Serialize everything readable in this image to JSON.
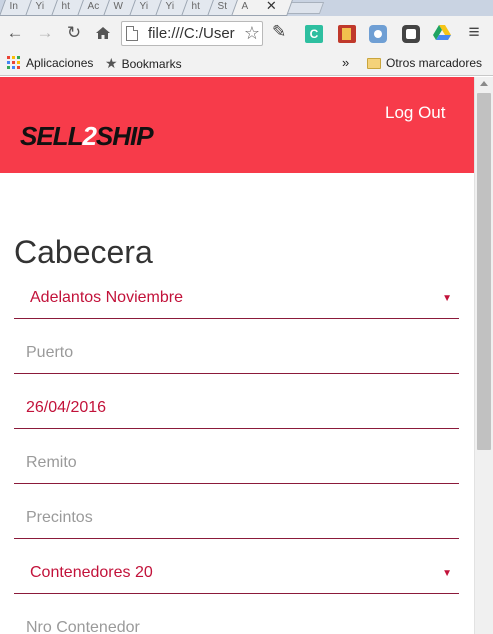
{
  "browser": {
    "tabs": [
      "In",
      "Yi",
      "ht",
      "Ac",
      "W",
      "Yi",
      "Yi",
      "ht",
      "St",
      "A"
    ],
    "active_tab_close": "✕",
    "url": "file:///C:/User",
    "bookmarks": {
      "apps_label": "Aplicaciones",
      "bookmarks_label": "Bookmarks",
      "overflow": "»",
      "other_label": "Otros marcadores"
    }
  },
  "app": {
    "brand_color": "#f73b4a",
    "accent_color": "#c2123a",
    "logo": {
      "part1": "SELL",
      "part2": "2",
      "part3": "SHIP"
    },
    "logout_label": "Log Out",
    "form": {
      "title": "Cabecera",
      "fields": [
        {
          "type": "select",
          "value": "Adelantos Noviembre",
          "placeholder": ""
        },
        {
          "type": "input",
          "value": "",
          "placeholder": "Puerto"
        },
        {
          "type": "input",
          "value": "26/04/2016",
          "placeholder": ""
        },
        {
          "type": "input",
          "value": "",
          "placeholder": "Remito"
        },
        {
          "type": "input",
          "value": "",
          "placeholder": "Precintos"
        },
        {
          "type": "select",
          "value": "Contenedores 20",
          "placeholder": ""
        },
        {
          "type": "input",
          "value": "",
          "placeholder": "Nro Contenedor"
        }
      ]
    }
  }
}
